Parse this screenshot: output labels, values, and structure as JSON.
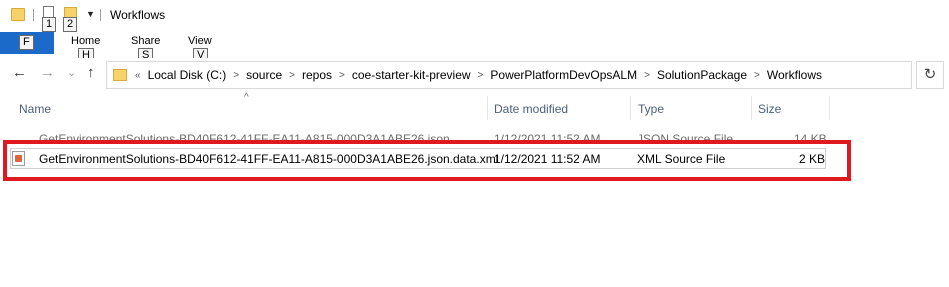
{
  "window": {
    "title": "Workflows"
  },
  "quick_access": {
    "keytips": [
      "1",
      "2"
    ]
  },
  "ribbon": {
    "file": {
      "keytip": "F"
    },
    "tabs": [
      {
        "label": "Home",
        "keytip": "H"
      },
      {
        "label": "Share",
        "keytip": "S"
      },
      {
        "label": "View",
        "keytip": "V"
      }
    ]
  },
  "nav": {
    "back": "←",
    "forward": "→",
    "recent": "⌄",
    "up": "↑",
    "overflow": "«",
    "refresh": "↻"
  },
  "breadcrumbs": [
    "Local Disk (C:)",
    "source",
    "repos",
    "coe-starter-kit-preview",
    "PowerPlatformDevOpsALM",
    "SolutionPackage",
    "Workflows"
  ],
  "columns": {
    "name": "Name",
    "date": "Date modified",
    "type": "Type",
    "size": "Size"
  },
  "files": [
    {
      "name": "GetEnvironmentSolutions-BD40F612-41FF-EA11-A815-000D3A1ABE26.json",
      "date": "1/12/2021 11:52 AM",
      "type": "JSON Source File",
      "size": "14 KB"
    },
    {
      "name": "GetEnvironmentSolutions-BD40F612-41FF-EA11-A815-000D3A1ABE26.json.data.xml",
      "date": "1/12/2021 11:52 AM",
      "type": "XML Source File",
      "size": "2 KB"
    }
  ],
  "colors": {
    "accent": "#1b6ac9",
    "highlight": "#e0191e",
    "header_text": "#4c607a"
  }
}
